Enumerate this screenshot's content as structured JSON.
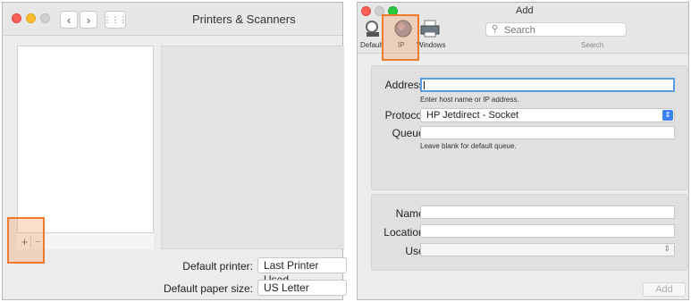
{
  "left": {
    "title": "Printers & Scanners",
    "grid_glyph": "⋮⋮⋮",
    "add_glyph": "+",
    "remove_glyph": "−",
    "default_printer_label": "Default printer:",
    "default_printer_value": "Last Printer Used",
    "default_paper_label": "Default paper size:",
    "default_paper_value": "US Letter"
  },
  "right": {
    "title": "Add",
    "search_placeholder": "Search",
    "search_label": "Search",
    "toolbar": [
      "Default",
      "IP",
      "Windows"
    ],
    "address_label": "Address:",
    "address_hint": "Enter host name or IP address.",
    "protocol_label": "Protocol:",
    "protocol_value": "HP Jetdirect - Socket",
    "queue_label": "Queue:",
    "queue_hint": "Leave blank for default queue.",
    "name_label": "Name:",
    "location_label": "Location:",
    "use_label": "Use:",
    "add_button": "Add"
  },
  "colors": {
    "highlight": "#f07a2c",
    "accent": "#3b82f6"
  }
}
